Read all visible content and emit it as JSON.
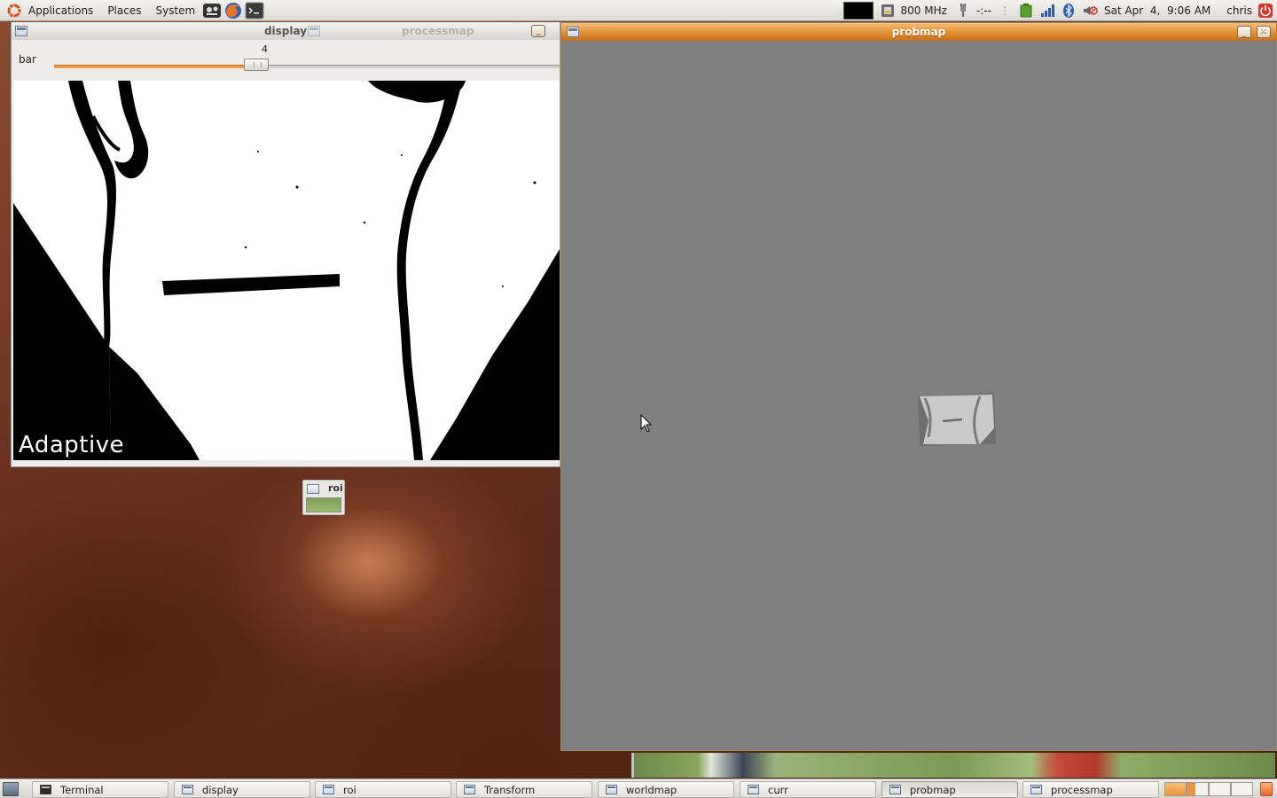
{
  "top_panel": {
    "menus": [
      "Applications",
      "Places",
      "System"
    ],
    "cpu_freq": "800 MHz",
    "battery_status": "-:--",
    "clock": "Sat Apr  4,  9:06 AM",
    "user": "chris"
  },
  "display_window": {
    "title": "display",
    "trackbar": {
      "label": "bar",
      "value": "4",
      "level_fraction": 0.4
    },
    "overlay_text": "Adaptive",
    "stacked_tab_title": "processmap"
  },
  "probmap_window": {
    "title": "probmap"
  },
  "minimized": {
    "roi_label": "roi"
  },
  "taskbar": {
    "tasks": [
      {
        "label": "Terminal",
        "icon": "terminal-icon",
        "active": false
      },
      {
        "label": "display",
        "icon": "window-icon",
        "active": false
      },
      {
        "label": "roi",
        "icon": "window-icon",
        "active": false
      },
      {
        "label": "Transform",
        "icon": "window-icon",
        "active": false
      },
      {
        "label": "worldmap",
        "icon": "window-icon",
        "active": false
      },
      {
        "label": "curr",
        "icon": "window-icon",
        "active": false
      },
      {
        "label": "probmap",
        "icon": "window-icon",
        "active": true
      },
      {
        "label": "processmap",
        "icon": "window-icon",
        "active": false
      }
    ],
    "workspace_count": 4,
    "active_workspace": 1
  },
  "colors": {
    "accent": "#e8973c",
    "trackbar_fill": "#f09a4a",
    "probmap_background": "#808080"
  }
}
